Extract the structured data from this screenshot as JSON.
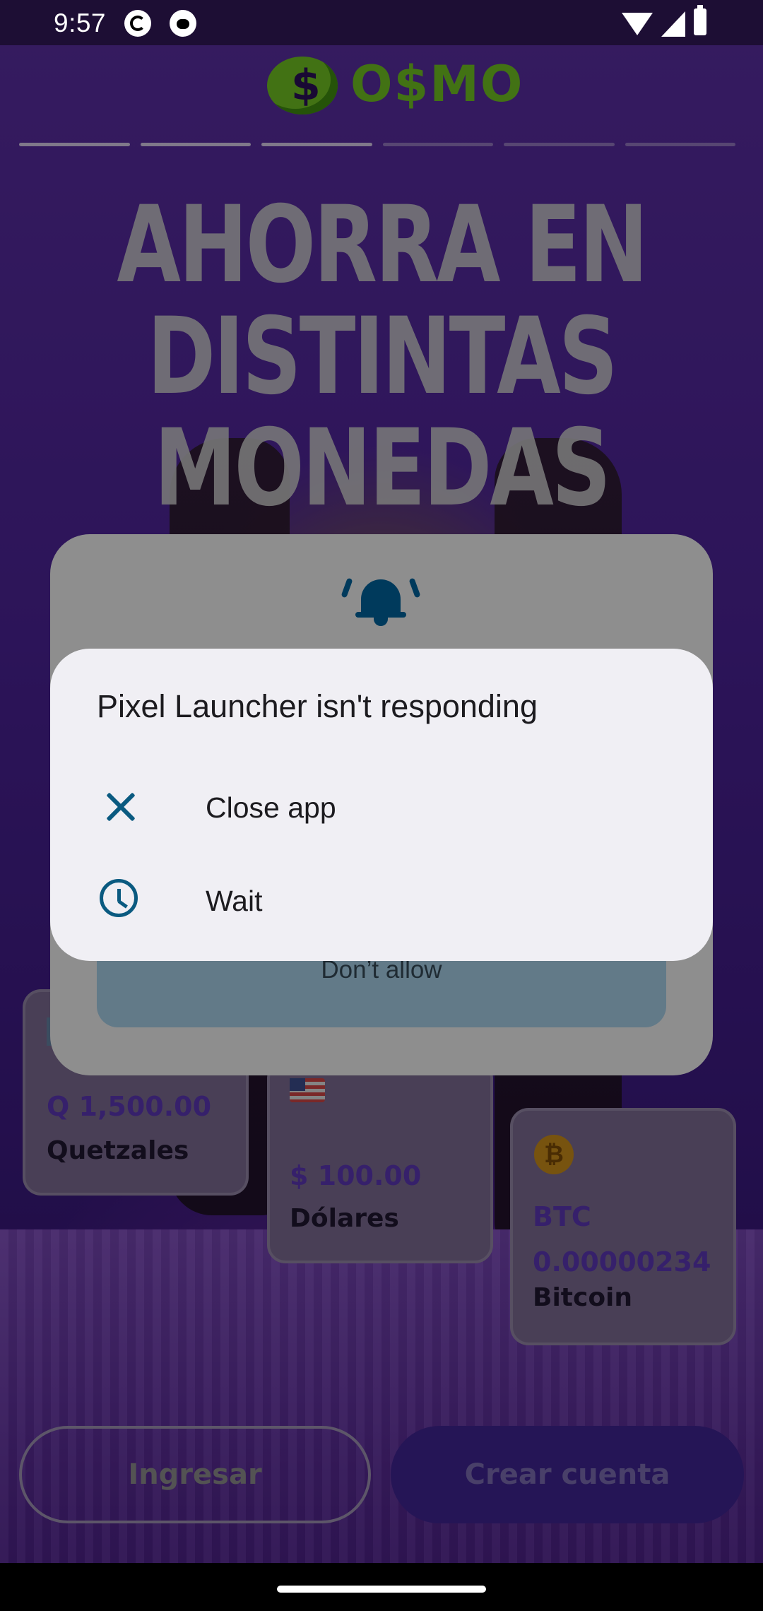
{
  "status_bar": {
    "time": "9:57",
    "icons": [
      "sync-app-icon",
      "cat-app-icon",
      "wifi-icon",
      "signal-icon",
      "battery-icon"
    ]
  },
  "app": {
    "logo_text": "O$MO",
    "accent_color": "#6fbf22",
    "brand_color": "#3e2390",
    "progress": {
      "total": 6,
      "current": 3
    },
    "headline": [
      "AHORRA EN",
      "DISTINTAS",
      "MONEDAS"
    ],
    "cards": [
      {
        "amount": "Q 1,500.00",
        "name": "Quetzales"
      },
      {
        "flag": "🇺🇸",
        "amount": "$ 100.00",
        "name": "Dólares"
      },
      {
        "amount_line1": "BTC",
        "amount_line2": "0.00000234",
        "name": "Bitcoin"
      }
    ],
    "buttons": {
      "login": "Ingresar",
      "create": "Crear cuenta"
    }
  },
  "permission_dialog": {
    "icon": "bell-icon",
    "deny_label": "Don’t allow"
  },
  "anr_dialog": {
    "title": "Pixel Launcher isn't responding",
    "options": [
      {
        "label": "Close app",
        "icon": "close-icon"
      },
      {
        "label": "Wait",
        "icon": "clock-icon"
      }
    ],
    "icon_color": "#0a5a80"
  }
}
